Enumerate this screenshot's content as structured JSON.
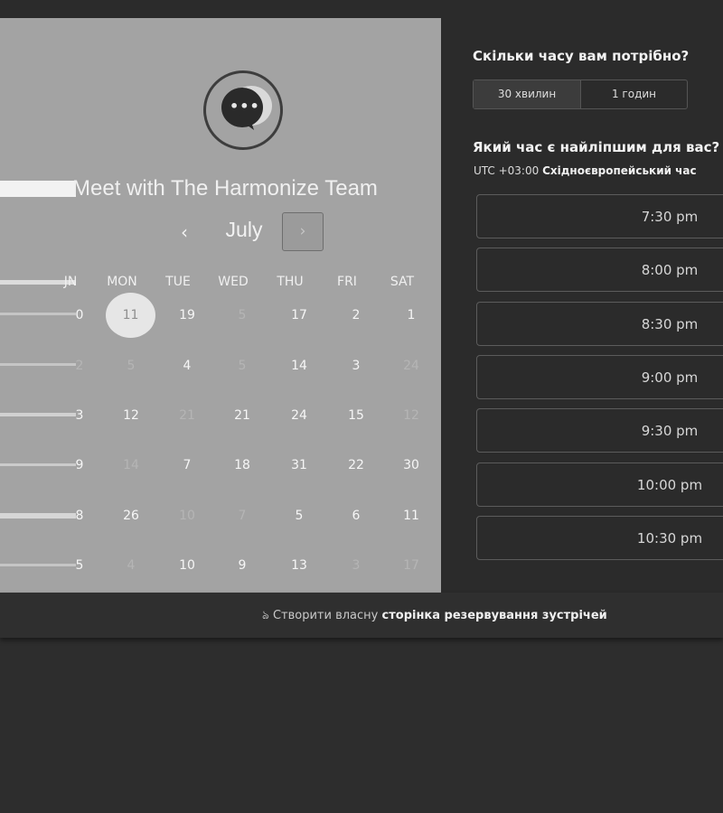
{
  "header": {
    "title": "Meet with The Harmonize Team"
  },
  "calendar": {
    "month": "July",
    "prev_icon": "‹",
    "next_icon": "›",
    "day_headers": [
      "JN",
      "MON",
      "TUE",
      "WED",
      "THU",
      "FRI",
      "SAT"
    ],
    "rows": [
      [
        {
          "t": "0",
          "m": false
        },
        {
          "t": "11",
          "m": false,
          "sel": true
        },
        {
          "t": "19",
          "m": false
        },
        {
          "t": "5",
          "m": true
        },
        {
          "t": "17",
          "m": false
        },
        {
          "t": "2",
          "m": false
        },
        {
          "t": "1",
          "m": false
        }
      ],
      [
        {
          "t": "2",
          "m": true
        },
        {
          "t": "5",
          "m": true
        },
        {
          "t": "4",
          "m": false
        },
        {
          "t": "5",
          "m": true
        },
        {
          "t": "14",
          "m": false
        },
        {
          "t": "3",
          "m": false
        },
        {
          "t": "24",
          "m": true
        }
      ],
      [
        {
          "t": "3",
          "m": false
        },
        {
          "t": "12",
          "m": false
        },
        {
          "t": "21",
          "m": true
        },
        {
          "t": "21",
          "m": false
        },
        {
          "t": "24",
          "m": false
        },
        {
          "t": "15",
          "m": false
        },
        {
          "t": "12",
          "m": true
        }
      ],
      [
        {
          "t": "9",
          "m": false
        },
        {
          "t": "14",
          "m": true
        },
        {
          "t": "7",
          "m": false
        },
        {
          "t": "18",
          "m": false
        },
        {
          "t": "31",
          "m": false
        },
        {
          "t": "22",
          "m": false
        },
        {
          "t": "30",
          "m": false
        }
      ],
      [
        {
          "t": "8",
          "m": false
        },
        {
          "t": "26",
          "m": false
        },
        {
          "t": "10",
          "m": true
        },
        {
          "t": "7",
          "m": true
        },
        {
          "t": "5",
          "m": false
        },
        {
          "t": "6",
          "m": false
        },
        {
          "t": "11",
          "m": false
        }
      ],
      [
        {
          "t": "5",
          "m": false
        },
        {
          "t": "4",
          "m": true
        },
        {
          "t": "10",
          "m": false
        },
        {
          "t": "9",
          "m": false
        },
        {
          "t": "13",
          "m": false
        },
        {
          "t": "3",
          "m": true
        },
        {
          "t": "17",
          "m": true
        }
      ]
    ]
  },
  "booking": {
    "duration_heading": "Скільки часу вам потрібно?",
    "durations": [
      "30 хвилин",
      "1 годин"
    ],
    "time_heading": "Який час є найліпшим для вас?",
    "timezone_offset": "UTC +03:00",
    "timezone_name": "Східноєвропейський час",
    "slots": [
      "7:30 pm",
      "8:00 pm",
      "8:30 pm",
      "9:00 pm",
      "9:30 pm",
      "10:00 pm",
      "10:30 pm"
    ]
  },
  "footer": {
    "icon": "hubspot-icon",
    "prefix": "Створити власну",
    "link": "сторінка резервування зустрічей"
  },
  "colors": {
    "left_panel": "#a3a3a3",
    "right_panel": "#2b2b2b",
    "page_bg": "#2d2d2d"
  }
}
